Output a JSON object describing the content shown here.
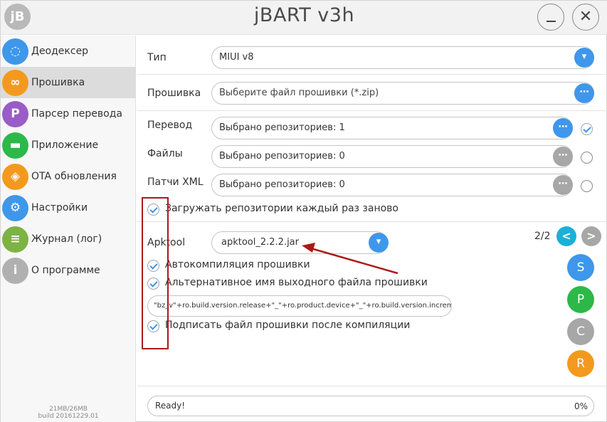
{
  "app": {
    "title": "jBART v3h",
    "logo_text": "jB"
  },
  "window_controls": {
    "minimize_glyph": "—",
    "close_glyph": "✕"
  },
  "sidebar": {
    "items": [
      {
        "label": "Деодексер",
        "icon": "circle-arrow-icon",
        "glyph": "◌",
        "color": "#3e97ea",
        "active": false
      },
      {
        "label": "Прошивка",
        "icon": "firmware-icon",
        "glyph": "∞",
        "color": "#f39a1e",
        "active": true
      },
      {
        "label": "Парсер перевода",
        "icon": "parser-icon",
        "glyph": "P",
        "color": "#9a5cc6",
        "active": false
      },
      {
        "label": "Приложение",
        "icon": "android-icon",
        "glyph": "▬",
        "color": "#2db84a",
        "active": false
      },
      {
        "label": "OTA обновления",
        "icon": "layers-icon",
        "glyph": "◈",
        "color": "#f39a1e",
        "active": false
      },
      {
        "label": "Настройки",
        "icon": "gear-icon",
        "glyph": "⚙",
        "color": "#3e97ea",
        "active": false
      },
      {
        "label": "Журнал (лог)",
        "icon": "log-icon",
        "glyph": "≡",
        "color": "#7cb342",
        "active": false
      },
      {
        "label": "О программе",
        "icon": "info-icon",
        "glyph": "i",
        "color": "#b0b0b0",
        "active": false
      }
    ],
    "memory": "21MB/26MB",
    "build": "build 20161229.01"
  },
  "main": {
    "type": {
      "label": "Тип",
      "value": "MIUI v8"
    },
    "firmware": {
      "label": "Прошивка",
      "placeholder": "Выберите файл прошивки (*.zip)"
    },
    "translation": {
      "label": "Перевод",
      "value": "Выбрано репозиториев: 1",
      "checked": true
    },
    "files": {
      "label": "Файлы",
      "value": "Выбрано репозиториев: 0",
      "checked": false
    },
    "patches": {
      "label": "Патчи XML",
      "value": "Выбрано репозиториев: 0",
      "checked": false
    },
    "reload_repos": {
      "label": "Загружать репозитории каждый раз заново",
      "checked": true
    },
    "apktool": {
      "label": "Apktool",
      "value": "apktool_2.2.2.jar"
    },
    "pager": {
      "text": "2/2",
      "prev_glyph": "<",
      "next_glyph": ">"
    },
    "autocompile": {
      "label": "Автокомпиляция прошивки",
      "checked": true
    },
    "alt_name": {
      "label": "Альтернативное имя выходного файла прошивки",
      "checked": true
    },
    "name_template": "\"bz_v\"+ro.build.version.release+\"_\"+ro.product.device+\"_\"+ro.build.version.incremen",
    "sign": {
      "label": "Подписать файл прошивки после компиляции",
      "checked": true
    },
    "side_buttons": [
      {
        "letter": "S",
        "color": "#3e97ea"
      },
      {
        "letter": "P",
        "color": "#2db84a"
      },
      {
        "letter": "C",
        "color": "#a7a7a7"
      },
      {
        "letter": "R",
        "color": "#f39a1e"
      }
    ],
    "status": {
      "text": "Ready!",
      "percent": "0%",
      "progress": 0
    }
  },
  "colors": {
    "accent": "#3e97ea",
    "annotation": "#b01818"
  },
  "dropdown_glyph": "▾",
  "ellipsis_glyph": "⋯"
}
